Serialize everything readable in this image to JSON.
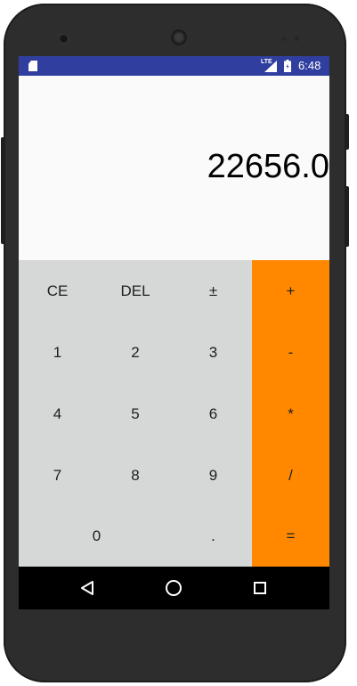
{
  "device": {
    "frame_color": "#2d2d2d"
  },
  "status_bar": {
    "background": "#303f9f",
    "network_label": "LTE",
    "time": "6:48",
    "icons": [
      "sd-card-icon",
      "signal-icon",
      "battery-icon"
    ]
  },
  "display": {
    "value": "22656.0"
  },
  "keypad": {
    "background": "#d6d7d7",
    "operator_background": "#ff8800",
    "rows": [
      [
        "CE",
        "DEL",
        "±",
        "+"
      ],
      [
        "1",
        "2",
        "3",
        "-"
      ],
      [
        "4",
        "5",
        "6",
        "*"
      ],
      [
        "7",
        "8",
        "9",
        "/"
      ],
      [
        "0",
        ".",
        "="
      ]
    ]
  },
  "nav_bar": {
    "icons": [
      "back-icon",
      "home-icon",
      "recents-icon"
    ]
  }
}
